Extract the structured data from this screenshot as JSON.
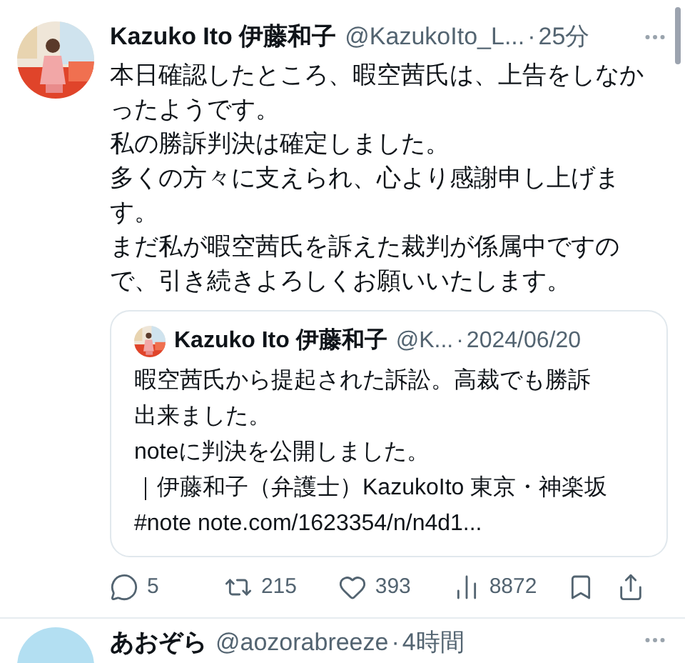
{
  "tweet": {
    "name": "Kazuko Ito 伊藤和子",
    "handle": "@KazukoIto_L...",
    "separator": "·",
    "time": "25分",
    "paragraphs": [
      "本日確認したところ、暇空茜氏は、上告をしなかったようです。",
      "私の勝訴判決は確定しました。",
      "多くの方々に支えられ、心より感謝申し上げます。",
      "まだ私が暇空茜氏を訴えた裁判が係属中ですので、引き続きよろしくお願いいたします。"
    ],
    "quote": {
      "name": "Kazuko Ito 伊藤和子",
      "handle": "@K...",
      "separator": "·",
      "date": "2024/06/20",
      "paragraphs": [
        "暇空茜氏から提起された訴訟。高裁でも勝訴出来ました。",
        "noteに判決を公開しました。",
        "｜伊藤和子（弁護士）KazukoIto 東京・神楽坂 #note note.com/1623354/n/n4d1..."
      ]
    },
    "actions": [
      {
        "kind": "reply",
        "count": "5"
      },
      {
        "kind": "retweet",
        "count": "215"
      },
      {
        "kind": "like",
        "count": "393"
      },
      {
        "kind": "views",
        "count": "8872"
      },
      {
        "kind": "bookmark"
      },
      {
        "kind": "share"
      }
    ]
  },
  "next_tweet": {
    "name": "あおぞら",
    "handle": "@aozorabreeze",
    "separator": "·",
    "time": "4時間"
  }
}
